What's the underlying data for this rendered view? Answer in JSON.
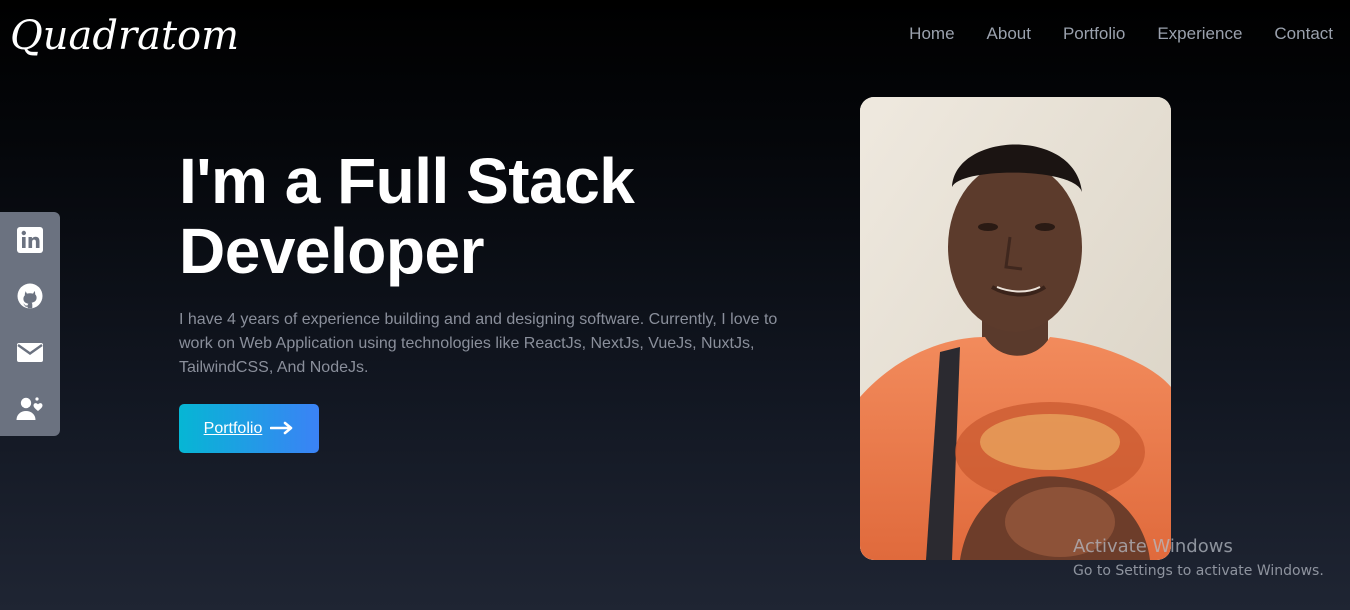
{
  "brand": {
    "logo_text": "Quadratom"
  },
  "nav": {
    "items": [
      {
        "label": "Home"
      },
      {
        "label": "About"
      },
      {
        "label": "Portfolio"
      },
      {
        "label": "Experience"
      },
      {
        "label": "Contact"
      }
    ]
  },
  "social": {
    "icons": [
      "linkedin-icon",
      "github-icon",
      "mail-icon",
      "users-heart-icon"
    ]
  },
  "hero": {
    "headline_line1": "I'm a Full Stack",
    "headline_line2": "Developer",
    "description": "I have 4 years of experience building and and designing software. Currently, I love to work on Web Application using technologies like ReactJs, NextJs, VueJs, NuxtJs, TailwindCSS, And NodeJs.",
    "cta_label": "Portfolio",
    "cta_icon": "arrow-right-icon"
  },
  "system": {
    "watermark_title": "Activate Windows",
    "watermark_subtitle": "Go to Settings to activate Windows."
  },
  "colors": {
    "accent_start": "#06b6d4",
    "accent_end": "#3b82f6",
    "social_bar": "#6b7280",
    "nav_text": "#9aa1ad"
  }
}
